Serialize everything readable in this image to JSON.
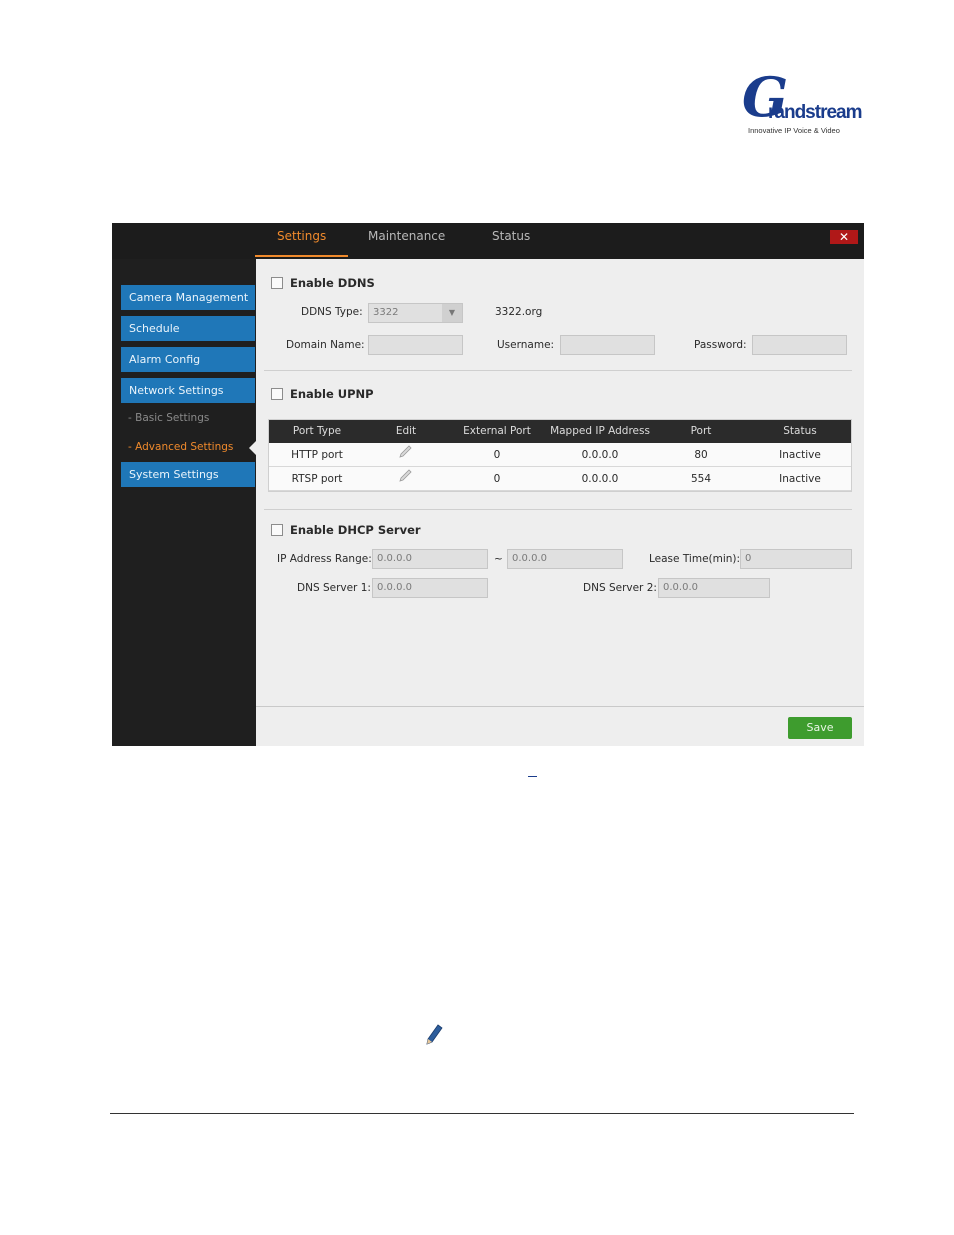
{
  "logo": {
    "letter": "G",
    "word": "randstream",
    "tagline": "Innovative IP Voice & Video"
  },
  "tabs": [
    {
      "label": "Settings",
      "active": true
    },
    {
      "label": "Maintenance",
      "active": false
    },
    {
      "label": "Status",
      "active": false
    }
  ],
  "close_label": "✕",
  "sidebar": {
    "items": [
      {
        "label": "Camera Management"
      },
      {
        "label": "Schedule"
      },
      {
        "label": "Alarm Config"
      },
      {
        "label": "Network Settings"
      },
      {
        "label": "- Basic Settings"
      },
      {
        "label": "- Advanced Settings",
        "active": true
      },
      {
        "label": "System Settings"
      }
    ]
  },
  "ddns": {
    "enable_label": "Enable DDNS",
    "type_label": "DDNS Type:",
    "type_value": "3322",
    "type_site": "3322.org",
    "domain_label": "Domain Name:",
    "domain_value": "",
    "username_label": "Username:",
    "username_value": "",
    "password_label": "Password:",
    "password_value": ""
  },
  "upnp": {
    "enable_label": "Enable UPNP",
    "columns": [
      "Port Type",
      "Edit",
      "External Port",
      "Mapped IP Address",
      "Port",
      "Status"
    ],
    "rows": [
      {
        "port_type": "HTTP port",
        "external_port": "0",
        "mapped_ip": "0.0.0.0",
        "port": "80",
        "status": "Inactive"
      },
      {
        "port_type": "RTSP port",
        "external_port": "0",
        "mapped_ip": "0.0.0.0",
        "port": "554",
        "status": "Inactive"
      }
    ]
  },
  "dhcp": {
    "enable_label": "Enable DHCP Server",
    "range_label": "IP Address Range:",
    "range_start": "0.0.0.0",
    "range_sep": "~",
    "range_end": "0.0.0.0",
    "lease_label": "Lease Time(min):",
    "lease_value": "0",
    "dns1_label": "DNS Server 1:",
    "dns1_value": "0.0.0.0",
    "dns2_label": "DNS Server 2:",
    "dns2_value": "0.0.0.0"
  },
  "save_label": "Save",
  "colors": {
    "accent": "#f08a2c",
    "nav": "#1f77b8",
    "save": "#3e9c2e",
    "close": "#b01818"
  }
}
